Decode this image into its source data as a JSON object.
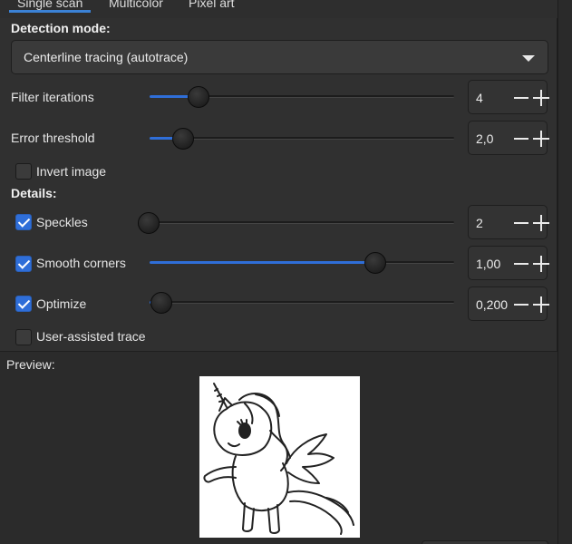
{
  "tabs": [
    {
      "label": "Single scan",
      "active": true
    },
    {
      "label": "Multicolor",
      "active": false
    },
    {
      "label": "Pixel art",
      "active": false
    }
  ],
  "detection_mode": {
    "label": "Detection mode:",
    "selected": "Centerline tracing (autotrace)"
  },
  "filter_iterations": {
    "label": "Filter iterations",
    "value": "4",
    "slider_fraction": 0.16
  },
  "error_threshold": {
    "label": "Error threshold",
    "value": "2,0",
    "slider_fraction": 0.11
  },
  "invert_image": {
    "label": "Invert image",
    "checked": false
  },
  "details": {
    "label": "Details:",
    "speckles": {
      "label": "Speckles",
      "checked": true,
      "value": "2",
      "slider_fraction": 0.0
    },
    "smooth_corners": {
      "label": "Smooth corners",
      "checked": true,
      "value": "1,00",
      "slider_fraction": 0.74
    },
    "optimize": {
      "label": "Optimize",
      "checked": true,
      "value": "0,200",
      "slider_fraction": 0.04
    }
  },
  "user_assisted_trace": {
    "label": "User-assisted trace",
    "checked": false
  },
  "preview": {
    "label": "Preview:"
  },
  "colors": {
    "accent": "#2f6ed8",
    "background": "#2b2b2b"
  }
}
